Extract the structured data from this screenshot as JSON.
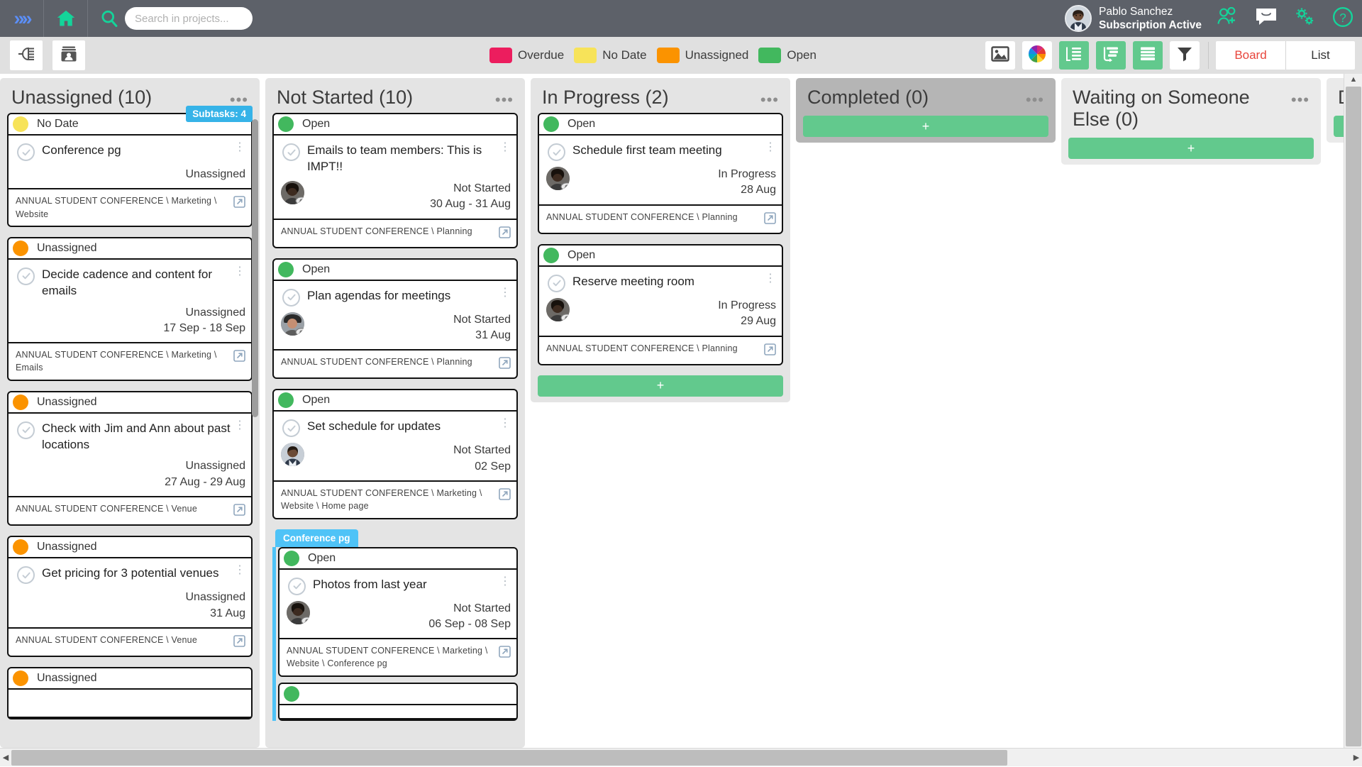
{
  "header": {
    "expand_icon": "double-chevron-right-icon",
    "home_icon": "home-icon",
    "search_icon": "search-icon",
    "search": {
      "value": "",
      "placeholder": "Search in projects..."
    },
    "user": {
      "name": "Pablo Sanchez",
      "status": "Subscription Active"
    },
    "icons": [
      "add-user-icon",
      "chat-icon",
      "settings-gear-icon",
      "help-icon"
    ]
  },
  "toolbar": {
    "left_buttons": [
      "workflow-icon",
      "contacts-icon"
    ],
    "legend": [
      {
        "label": "Overdue",
        "color": "#ec1d5e"
      },
      {
        "label": "No Date",
        "color": "#f7e359"
      },
      {
        "label": "Unassigned",
        "color": "#fb9300"
      },
      {
        "label": "Open",
        "color": "#42b85e"
      }
    ],
    "right_buttons": [
      {
        "name": "image-icon",
        "style": "white"
      },
      {
        "name": "color-wheel-icon",
        "style": "white"
      },
      {
        "name": "outline-list-icon",
        "style": "green"
      },
      {
        "name": "gantt-icon",
        "style": "green"
      },
      {
        "name": "table-rows-icon",
        "style": "green"
      },
      {
        "name": "filter-funnel-icon",
        "style": "white"
      }
    ],
    "view_tabs": [
      {
        "label": "Board",
        "active": true
      },
      {
        "label": "List",
        "active": false
      }
    ]
  },
  "board": {
    "add_label": "+",
    "columns": [
      {
        "title": "Unassigned (10)",
        "style": "light",
        "cards": [
          {
            "status": "No Date",
            "status_color": "#f7e359",
            "badge": "Subtasks: 4",
            "title": "Conference pg",
            "assignee": null,
            "meta1": "Unassigned",
            "meta2": "",
            "path": "ANNUAL STUDENT CONFERENCE \\ Marketing \\ Website"
          },
          {
            "status": "Unassigned",
            "status_color": "#fb9300",
            "badge": null,
            "title": "Decide cadence and content for emails",
            "assignee": null,
            "meta1": "Unassigned",
            "meta2": "17 Sep - 18 Sep",
            "path": "ANNUAL STUDENT CONFERENCE \\ Marketing \\ Emails"
          },
          {
            "status": "Unassigned",
            "status_color": "#fb9300",
            "badge": null,
            "title": "Check with Jim and Ann about past locations",
            "assignee": null,
            "meta1": "Unassigned",
            "meta2": "27 Aug - 29 Aug",
            "path": "ANNUAL STUDENT CONFERENCE \\ Venue"
          },
          {
            "status": "Unassigned",
            "status_color": "#fb9300",
            "badge": null,
            "title": "Get pricing for 3 potential venues",
            "assignee": null,
            "meta1": "Unassigned",
            "meta2": "31 Aug",
            "path": "ANNUAL STUDENT CONFERENCE \\ Venue"
          },
          {
            "status": "Unassigned",
            "status_color": "#fb9300",
            "badge": null,
            "title": "",
            "assignee": null,
            "meta1": "",
            "meta2": "",
            "path": ""
          }
        ]
      },
      {
        "title": "Not Started (10)",
        "style": "light",
        "cards": [
          {
            "status": "Open",
            "status_color": "#42b85e",
            "badge": null,
            "title": "Emails to team members: This is IMPT!!",
            "assignee": "avatar-dark",
            "meta1": "Not Started",
            "meta2": "30 Aug - 31 Aug",
            "path": "ANNUAL STUDENT CONFERENCE \\ Planning"
          },
          {
            "status": "Open",
            "status_color": "#42b85e",
            "badge": null,
            "title": "Plan agendas for meetings",
            "assignee": "avatar-hat",
            "meta1": "Not Started",
            "meta2": "31 Aug",
            "path": "ANNUAL STUDENT CONFERENCE \\ Planning"
          },
          {
            "status": "Open",
            "status_color": "#42b85e",
            "badge": null,
            "title": "Set schedule for updates",
            "assignee": "avatar-suit",
            "meta1": "Not Started",
            "meta2": "02 Sep",
            "path": "ANNUAL STUDENT CONFERENCE \\ Marketing \\ Website \\ Home page"
          }
        ],
        "group": {
          "tag": "Conference pg",
          "cards": [
            {
              "status": "Open",
              "status_color": "#42b85e",
              "badge": null,
              "title": "Photos from last year",
              "assignee": "avatar-dark",
              "meta1": "Not Started",
              "meta2": "06 Sep - 08 Sep",
              "path": "ANNUAL STUDENT CONFERENCE \\ Marketing \\ Website \\ Conference pg"
            }
          ]
        }
      },
      {
        "title": "In Progress (2)",
        "style": "light",
        "cards": [
          {
            "status": "Open",
            "status_color": "#42b85e",
            "badge": null,
            "title": "Schedule first team meeting",
            "assignee": "avatar-dark",
            "meta1": "In Progress",
            "meta2": "28 Aug",
            "path": "ANNUAL STUDENT CONFERENCE \\ Planning"
          },
          {
            "status": "Open",
            "status_color": "#42b85e",
            "badge": null,
            "title": "Reserve meeting room",
            "assignee": "avatar-dark",
            "meta1": "In Progress",
            "meta2": "29 Aug",
            "path": "ANNUAL STUDENT CONFERENCE \\ Planning"
          }
        ],
        "has_add": true
      },
      {
        "title": "Completed (0)",
        "style": "gray",
        "cards": [],
        "has_add": true
      },
      {
        "title": "Waiting on Someone Else (0)",
        "style": "light",
        "cards": [],
        "has_add": true
      },
      {
        "title": "Defe",
        "style": "light",
        "cards": [],
        "has_add": true
      }
    ]
  }
}
